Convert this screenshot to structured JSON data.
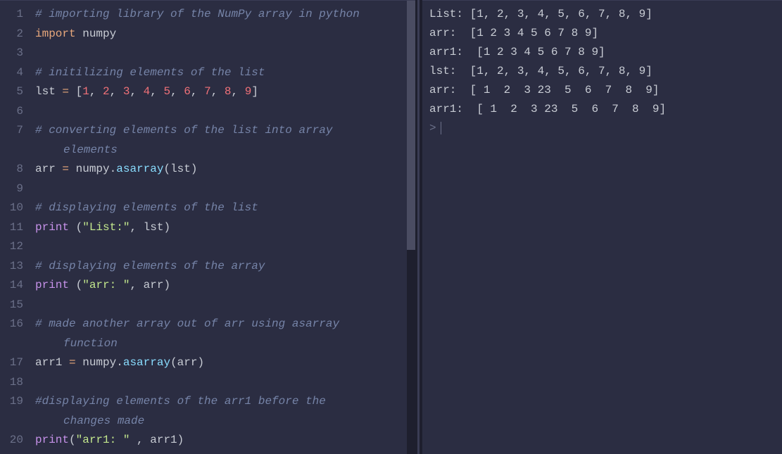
{
  "editor": {
    "lines": [
      {
        "num": 1,
        "tokens": [
          [
            "comment",
            "# importing library of the NumPy array in python"
          ]
        ]
      },
      {
        "num": 2,
        "tokens": [
          [
            "keyword",
            "import"
          ],
          [
            "ident",
            " numpy"
          ]
        ]
      },
      {
        "num": 3,
        "tokens": []
      },
      {
        "num": 4,
        "tokens": [
          [
            "comment",
            "# initilizing elements of the list"
          ]
        ]
      },
      {
        "num": 5,
        "tokens": [
          [
            "ident",
            "lst "
          ],
          [
            "oper",
            "="
          ],
          [
            "punct",
            " ["
          ],
          [
            "number",
            "1"
          ],
          [
            "punct",
            ", "
          ],
          [
            "number",
            "2"
          ],
          [
            "punct",
            ", "
          ],
          [
            "number",
            "3"
          ],
          [
            "punct",
            ", "
          ],
          [
            "number",
            "4"
          ],
          [
            "punct",
            ", "
          ],
          [
            "number",
            "5"
          ],
          [
            "punct",
            ", "
          ],
          [
            "number",
            "6"
          ],
          [
            "punct",
            ", "
          ],
          [
            "number",
            "7"
          ],
          [
            "punct",
            ", "
          ],
          [
            "number",
            "8"
          ],
          [
            "punct",
            ", "
          ],
          [
            "number",
            "9"
          ],
          [
            "punct",
            "]"
          ]
        ]
      },
      {
        "num": 6,
        "tokens": []
      },
      {
        "num": 7,
        "tokens": [
          [
            "comment",
            "# converting elements of the list into array "
          ]
        ],
        "wrap": [
          [
            "comment",
            "elements"
          ]
        ]
      },
      {
        "num": 8,
        "tokens": [
          [
            "ident",
            "arr "
          ],
          [
            "oper",
            "="
          ],
          [
            "ident",
            " numpy"
          ],
          [
            "punct",
            "."
          ],
          [
            "func",
            "asarray"
          ],
          [
            "punct",
            "("
          ],
          [
            "ident",
            "lst"
          ],
          [
            "punct",
            ")"
          ]
        ]
      },
      {
        "num": 9,
        "tokens": []
      },
      {
        "num": 10,
        "tokens": [
          [
            "comment",
            "# displaying elements of the list"
          ]
        ]
      },
      {
        "num": 11,
        "tokens": [
          [
            "builtin",
            "print"
          ],
          [
            "punct",
            " ("
          ],
          [
            "string",
            "\"List:\""
          ],
          [
            "punct",
            ", "
          ],
          [
            "ident",
            "lst"
          ],
          [
            "punct",
            ")"
          ]
        ]
      },
      {
        "num": 12,
        "tokens": []
      },
      {
        "num": 13,
        "tokens": [
          [
            "comment",
            "# displaying elements of the array"
          ]
        ]
      },
      {
        "num": 14,
        "tokens": [
          [
            "builtin",
            "print"
          ],
          [
            "punct",
            " ("
          ],
          [
            "string",
            "\"arr: \""
          ],
          [
            "punct",
            ", "
          ],
          [
            "ident",
            "arr"
          ],
          [
            "punct",
            ")"
          ]
        ]
      },
      {
        "num": 15,
        "tokens": []
      },
      {
        "num": 16,
        "tokens": [
          [
            "comment",
            "# made another array out of arr using asarray "
          ]
        ],
        "wrap": [
          [
            "comment",
            "function"
          ]
        ]
      },
      {
        "num": 17,
        "tokens": [
          [
            "ident",
            "arr1 "
          ],
          [
            "oper",
            "="
          ],
          [
            "ident",
            " numpy"
          ],
          [
            "punct",
            "."
          ],
          [
            "func",
            "asarray"
          ],
          [
            "punct",
            "("
          ],
          [
            "ident",
            "arr"
          ],
          [
            "punct",
            ")"
          ]
        ]
      },
      {
        "num": 18,
        "tokens": []
      },
      {
        "num": 19,
        "tokens": [
          [
            "comment",
            "#displaying elements of the arr1 before the "
          ]
        ],
        "wrap": [
          [
            "comment",
            "changes made"
          ]
        ]
      },
      {
        "num": 20,
        "tokens": [
          [
            "builtin",
            "print"
          ],
          [
            "punct",
            "("
          ],
          [
            "string",
            "\"arr1: \""
          ],
          [
            "punct",
            " , "
          ],
          [
            "ident",
            "arr1"
          ],
          [
            "punct",
            ")"
          ]
        ]
      }
    ]
  },
  "output": {
    "lines": [
      "List: [1, 2, 3, 4, 5, 6, 7, 8, 9]",
      "arr:  [1 2 3 4 5 6 7 8 9]",
      "arr1:  [1 2 3 4 5 6 7 8 9]",
      "lst:  [1, 2, 3, 4, 5, 6, 7, 8, 9]",
      "arr:  [ 1  2  3 23  5  6  7  8  9]",
      "arr1:  [ 1  2  3 23  5  6  7  8  9]"
    ],
    "prompt": ">"
  }
}
